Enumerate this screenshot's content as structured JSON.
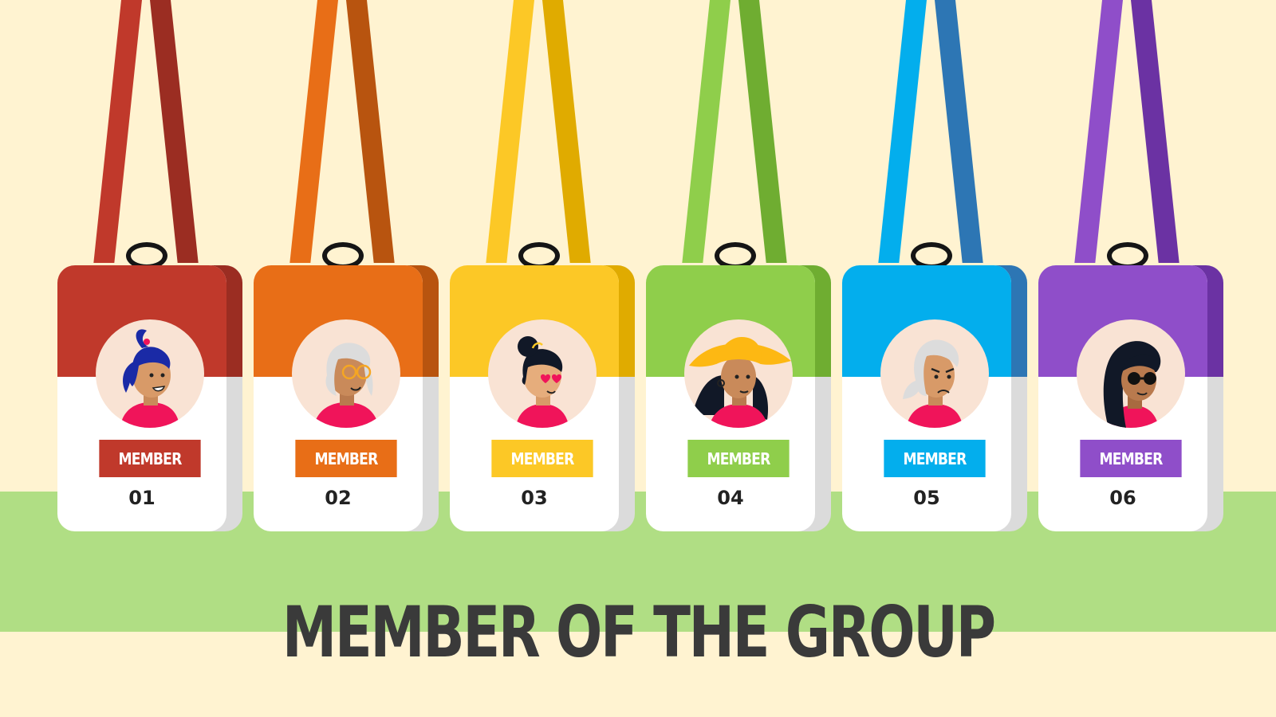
{
  "title": "MEMBER OF THE GROUP",
  "colors": {
    "background": "#fff3d1",
    "band": "#b0de84",
    "title_text": "#3a3a3a"
  },
  "badges": [
    {
      "label": "MEMBER",
      "number": "01",
      "color": "#c0392b",
      "dark": "#9b2d22",
      "avatar_icon": "woman-blue-ponytail-icon"
    },
    {
      "label": "MEMBER",
      "number": "02",
      "color": "#e86e17",
      "dark": "#b8540f",
      "avatar_icon": "woman-gray-hair-glasses-icon"
    },
    {
      "label": "MEMBER",
      "number": "03",
      "color": "#fcc826",
      "dark": "#e0ab00",
      "avatar_icon": "woman-hair-bun-heart-eyes-icon"
    },
    {
      "label": "MEMBER",
      "number": "04",
      "color": "#8fce4b",
      "dark": "#6fad31",
      "avatar_icon": "woman-yellow-hat-icon"
    },
    {
      "label": "MEMBER",
      "number": "05",
      "color": "#03aeed",
      "dark": "#2d76b4",
      "avatar_icon": "woman-gray-hair-frown-icon"
    },
    {
      "label": "MEMBER",
      "number": "06",
      "color": "#8f4ec9",
      "dark": "#6b32a3",
      "avatar_icon": "woman-sunglasses-long-hair-icon"
    }
  ]
}
